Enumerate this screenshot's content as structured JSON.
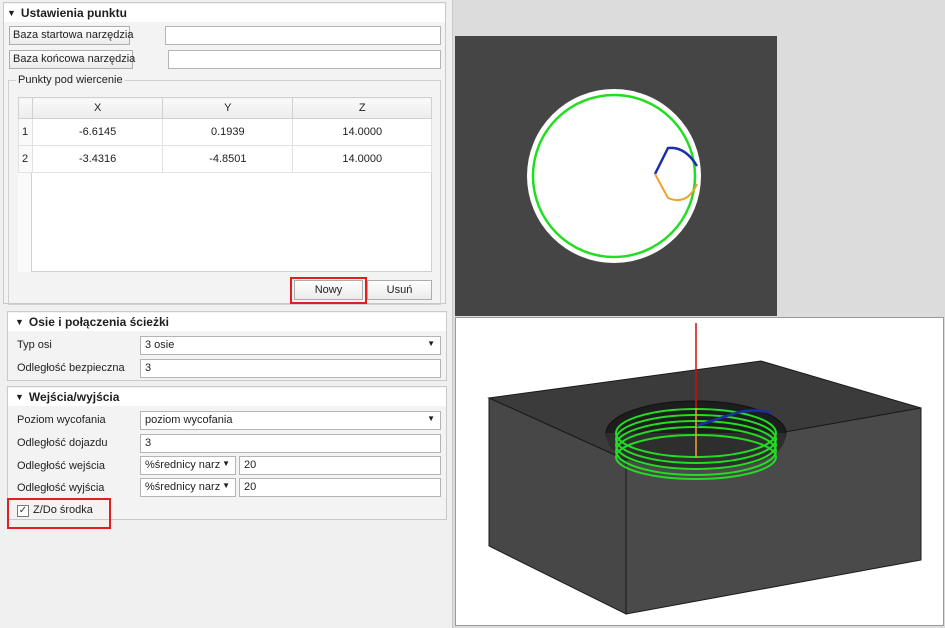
{
  "point_settings": {
    "title": "Ustawienia punktu",
    "start_base_label": "Baza startowa narzędzia",
    "start_base_value": "",
    "end_base_label": "Baza końcowa narzędzia",
    "end_base_value": "",
    "points_group_label": "Punkty pod wiercenie",
    "columns": [
      "X",
      "Y",
      "Z"
    ],
    "rows": [
      {
        "n": "1",
        "x": "-6.6145",
        "y": "0.1939",
        "z": "14.0000"
      },
      {
        "n": "2",
        "x": "-3.4316",
        "y": "-4.8501",
        "z": "14.0000"
      }
    ],
    "new_button": "Nowy",
    "delete_button": "Usuń"
  },
  "axes": {
    "title": "Osie i połączenia ścieżki",
    "axis_type_label": "Typ osi",
    "axis_type_value": "3 osie",
    "safe_distance_label": "Odległość bezpieczna",
    "safe_distance_value": "3"
  },
  "io": {
    "title": "Wejścia/wyjścia",
    "retract_level_label": "Poziom wycofania",
    "retract_level_value": "poziom wycofania",
    "approach_label": "Odległość dojazdu",
    "approach_value": "3",
    "entry_label": "Odległość wejścia",
    "entry_unit": "%średnicy narz",
    "entry_value": "20",
    "exit_label": "Odległość wyjścia",
    "exit_unit": "%średnicy narz",
    "exit_value": "20",
    "center_label": "Z/Do środka",
    "center_checked": true
  },
  "colors": {
    "highlight": "#e02020",
    "viewport_bg": "#454545",
    "path_green": "#22dd22",
    "path_blue": "#1a2fa8",
    "path_orange": "#f0a030",
    "tool_red": "#cc1111"
  }
}
